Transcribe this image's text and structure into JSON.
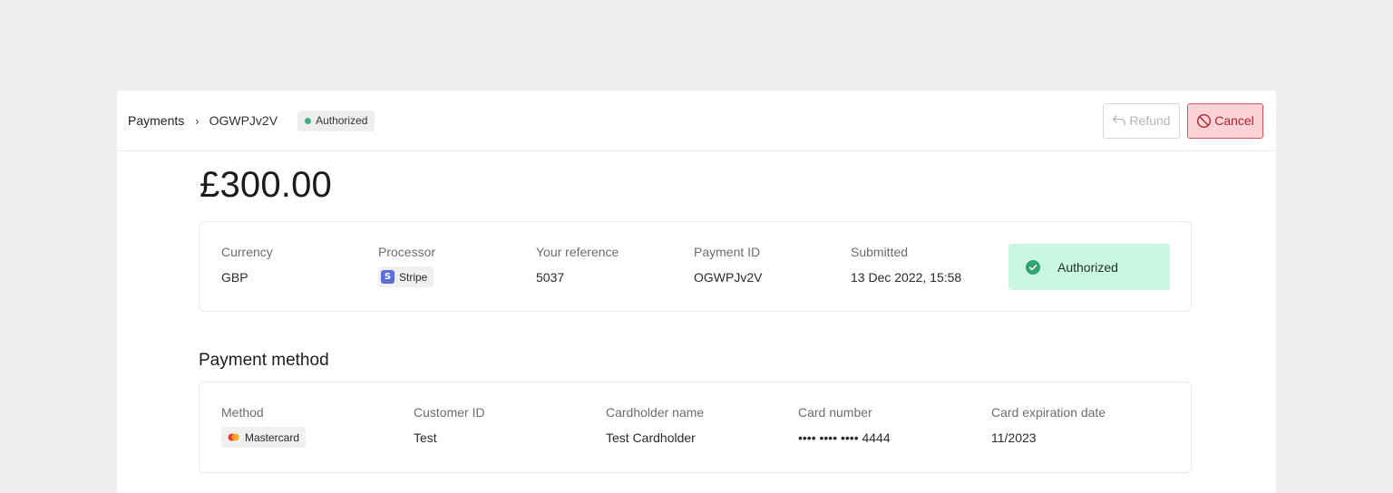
{
  "breadcrumb": {
    "root": "Payments",
    "separator": "›",
    "current": "OGWPJv2V"
  },
  "status_pill": "Authorized",
  "actions": {
    "refund_label": "Refund",
    "cancel_label": "Cancel"
  },
  "amount": "£300.00",
  "summary": {
    "currency_label": "Currency",
    "currency_value": "GBP",
    "processor_label": "Processor",
    "processor_value": "Stripe",
    "processor_icon": "S",
    "reference_label": "Your reference",
    "reference_value": "5037",
    "payment_id_label": "Payment ID",
    "payment_id_value": "OGWPJv2V",
    "submitted_label": "Submitted",
    "submitted_value": "13 Dec 2022, 15:58",
    "status_box": "Authorized"
  },
  "payment_method": {
    "title": "Payment method",
    "method_label": "Method",
    "method_value": "Mastercard",
    "customer_id_label": "Customer ID",
    "customer_id_value": "Test",
    "cardholder_label": "Cardholder name",
    "cardholder_value": "Test Cardholder",
    "card_number_label": "Card number",
    "card_number_value": "•••• •••• •••• 4444",
    "expiry_label": "Card expiration date",
    "expiry_value": "11/2023"
  },
  "colors": {
    "authorized_green": "#3fae7a",
    "authorized_box_bg": "#c9f7e3",
    "cancel_bg": "#fcd3d6",
    "cancel_border": "#d9535f",
    "stripe_purple": "#5e6ed9"
  },
  "icons": {
    "refund": "refund-arrow-icon",
    "cancel": "ban-icon",
    "status": "check-circle-icon",
    "processor": "stripe-icon",
    "method": "mastercard-icon"
  }
}
